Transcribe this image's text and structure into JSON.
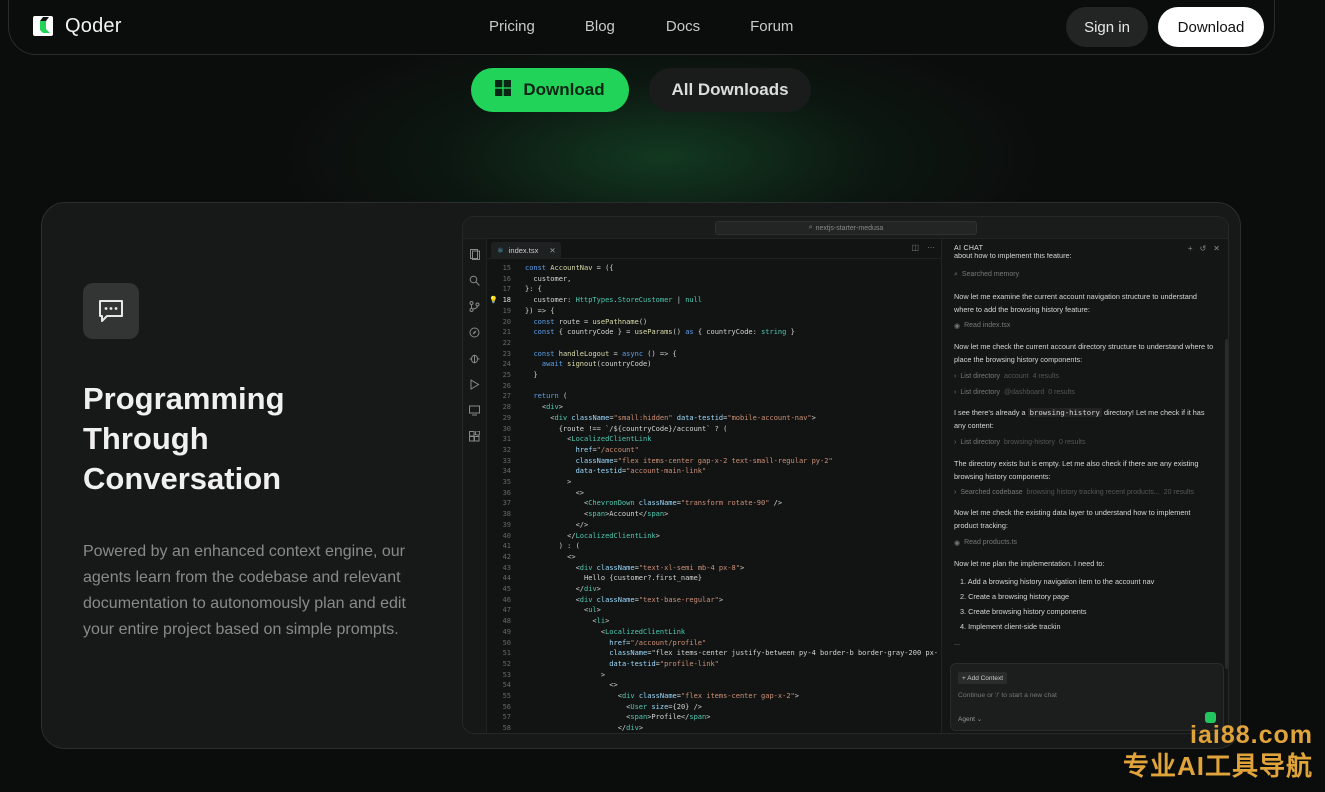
{
  "nav": {
    "brand": "Qoder",
    "links": [
      "Pricing",
      "Blog",
      "Docs",
      "Forum"
    ],
    "signin_label": "Sign in",
    "download_label": "Download"
  },
  "hero": {
    "download_label": "Download",
    "all_downloads_label": "All Downloads"
  },
  "feature": {
    "title": "Programming Through Conversation",
    "description": "Powered by an enhanced context engine, our agents learn from the codebase and relevant documentation to autonomously plan and edit your entire project based on simple prompts."
  },
  "ide": {
    "search_text": "nextjs-starter-medusa",
    "tab_label": "index.tsx",
    "code_lines": [
      {
        "n": "15",
        "t": "const AccountNav = ({"
      },
      {
        "n": "16",
        "t": "  customer,"
      },
      {
        "n": "17",
        "t": "}: {"
      },
      {
        "n": "18",
        "t": "  customer: HttpTypes.StoreCustomer | null"
      },
      {
        "n": "19",
        "t": "}) => {"
      },
      {
        "n": "20",
        "t": "  const route = usePathname()"
      },
      {
        "n": "21",
        "t": "  const { countryCode } = useParams() as { countryCode: string }"
      },
      {
        "n": "22",
        "t": ""
      },
      {
        "n": "23",
        "t": "  const handleLogout = async () => {"
      },
      {
        "n": "24",
        "t": "    await signout(countryCode)"
      },
      {
        "n": "25",
        "t": "  }"
      },
      {
        "n": "26",
        "t": ""
      },
      {
        "n": "27",
        "t": "  return ("
      },
      {
        "n": "28",
        "t": "    <div>"
      },
      {
        "n": "29",
        "t": "      <div className=\"small:hidden\" data-testid=\"mobile-account-nav\">"
      },
      {
        "n": "30",
        "t": "        {route !== `/${countryCode}/account` ? ("
      },
      {
        "n": "31",
        "t": "          <LocalizedClientLink"
      },
      {
        "n": "32",
        "t": "            href=\"/account\""
      },
      {
        "n": "33",
        "t": "            className=\"flex items-center gap-x-2 text-small-regular py-2\""
      },
      {
        "n": "34",
        "t": "            data-testid=\"account-main-link\""
      },
      {
        "n": "35",
        "t": "          >"
      },
      {
        "n": "36",
        "t": "            <>"
      },
      {
        "n": "37",
        "t": "              <ChevronDown className=\"transform rotate-90\" />"
      },
      {
        "n": "38",
        "t": "              <span>Account</span>"
      },
      {
        "n": "39",
        "t": "            </>"
      },
      {
        "n": "40",
        "t": "          </LocalizedClientLink>"
      },
      {
        "n": "41",
        "t": "        ) : ("
      },
      {
        "n": "42",
        "t": "          <>"
      },
      {
        "n": "43",
        "t": "            <div className=\"text-xl-semi mb-4 px-8\">"
      },
      {
        "n": "44",
        "t": "              Hello {customer?.first_name}"
      },
      {
        "n": "45",
        "t": "            </div>"
      },
      {
        "n": "46",
        "t": "            <div className=\"text-base-regular\">"
      },
      {
        "n": "47",
        "t": "              <ul>"
      },
      {
        "n": "48",
        "t": "                <li>"
      },
      {
        "n": "49",
        "t": "                  <LocalizedClientLink"
      },
      {
        "n": "50",
        "t": "                    href=\"/account/profile\""
      },
      {
        "n": "51",
        "t": "                    className=\"flex items-center justify-between py-4 border-b border-gray-200 px-"
      },
      {
        "n": "52",
        "t": "                    data-testid=\"profile-link\""
      },
      {
        "n": "53",
        "t": "                  >"
      },
      {
        "n": "54",
        "t": "                    <>"
      },
      {
        "n": "55",
        "t": "                      <div className=\"flex items-center gap-x-2\">"
      },
      {
        "n": "56",
        "t": "                        <User size={20} />"
      },
      {
        "n": "57",
        "t": "                        <span>Profile</span>"
      },
      {
        "n": "58",
        "t": "                      </div>"
      }
    ],
    "chat": {
      "header": "AI CHAT",
      "top_text": "about how to implement this feature:",
      "step_memory": "Searched memory",
      "msg1": "Now let me examine the current account navigation structure to understand where to add the browsing history feature:",
      "step_read1": "Read index.tsx",
      "msg2": "Now let me check the current account directory structure to understand where to place the browsing history components:",
      "step_list1_a": "List directory",
      "step_list1_b": "account",
      "step_list1_c": "4 results",
      "step_list2_a": "List directory",
      "step_list2_b": "@dashboard",
      "step_list2_c": "0 results",
      "msg3_a": "I see there's already a",
      "msg3_code": "browsing-history",
      "msg3_b": "directory! Let me check if it has any content:",
      "step_list3_a": "List directory",
      "step_list3_b": "browsing-history",
      "step_list3_c": "0 results",
      "msg4": "The directory exists but is empty. Let me also check if there are any existing browsing history components:",
      "step_search_a": "Searched codebase",
      "step_search_b": "browsing history tracking recent products...",
      "step_search_c": "20 results",
      "msg5": "Now let me check the existing data layer to understand how to implement product tracking:",
      "step_read2": "Read products.ts",
      "msg6": "Now let me plan the implementation. I need to:",
      "plan": [
        "1. Add a browsing history navigation item to the account nav",
        "2. Create a browsing history page",
        "3. Create browsing history components",
        "4. Implement client-side trackin"
      ],
      "ellipsis": "...",
      "add_context": "+ Add Context",
      "input_placeholder": "Continue or '/' to start a new chat",
      "agent_label": "Agent ⌄"
    }
  },
  "watermark": {
    "url": "iai88.com",
    "cn": "专业AI工具导航"
  },
  "colors": {
    "accent_green": "#22d35a",
    "background": "#0b0c0c",
    "card": "#171818",
    "watermark": "#e0a43a"
  }
}
